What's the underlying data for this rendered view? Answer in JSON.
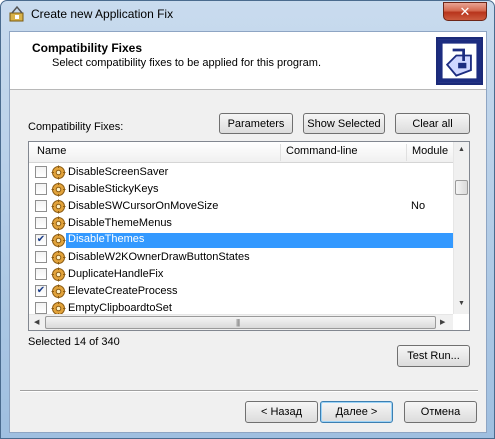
{
  "window": {
    "title": "Create new Application Fix"
  },
  "header": {
    "title": "Compatibility Fixes",
    "subtitle": "Select compatibility fixes to be applied for this program."
  },
  "fixes_label": "Compatibility Fixes:",
  "toolbar": {
    "parameters": "Parameters",
    "show_selected": "Show Selected",
    "clear_all": "Clear all"
  },
  "list": {
    "columns": [
      "Name",
      "Command-line",
      "Module"
    ],
    "rows": [
      {
        "name": "DisableScreenSaver",
        "checked": false,
        "cmd": ""
      },
      {
        "name": "DisableStickyKeys",
        "checked": false,
        "cmd": ""
      },
      {
        "name": "DisableSWCursorOnMoveSize",
        "checked": false,
        "cmd": "No"
      },
      {
        "name": "DisableThemeMenus",
        "checked": false,
        "cmd": ""
      },
      {
        "name": "DisableThemes",
        "checked": true,
        "cmd": "",
        "selected": true
      },
      {
        "name": "DisableW2KOwnerDrawButtonStates",
        "checked": false,
        "cmd": ""
      },
      {
        "name": "DuplicateHandleFix",
        "checked": false,
        "cmd": ""
      },
      {
        "name": "ElevateCreateProcess",
        "checked": true,
        "cmd": ""
      },
      {
        "name": "EmptyClipboardtoSet",
        "checked": false,
        "cmd": ""
      }
    ]
  },
  "status": "Selected 14 of 340",
  "test_run": "Test Run...",
  "footer": {
    "back": "< Назад",
    "next": "Далее >",
    "cancel": "Отмена"
  }
}
